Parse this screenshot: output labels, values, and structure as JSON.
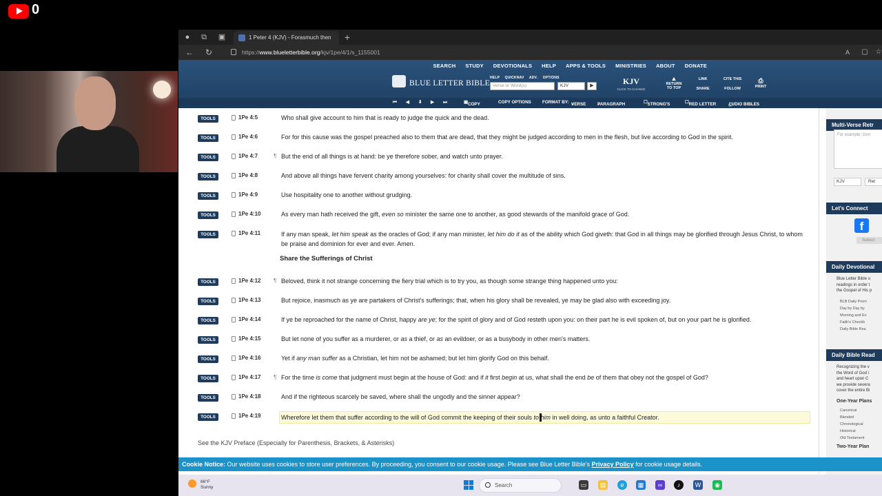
{
  "stream": {
    "view_count": "0"
  },
  "browser": {
    "tab_title": "1 Peter 4 (KJV) - Forasmuch then",
    "url_prefix": "https://",
    "url_host": "www.blueletterbible.org",
    "url_path": "/kjv/1pe/4/1/s_1155001"
  },
  "header": {
    "nav": [
      "SEARCH",
      "STUDY",
      "DEVOTIONALS",
      "HELP",
      "APPS & TOOLS",
      "MINISTRIES",
      "ABOUT",
      "DONATE"
    ],
    "logo": "BLUE LETTER BIBLE",
    "search_options": "HELP  QUICKNAV  ADV. OPTIONS",
    "search_placeholder": "Verse or Word(s)",
    "version": "KJV",
    "version_badge": "KJV",
    "version_badge_sub": "CLICK TO CHANGE",
    "return_to_top": "RETURN TO TOP",
    "link": "LINK",
    "share": "SHARE",
    "cite_this": "CITE THIS",
    "follow": "FOLLOW",
    "print": "PRINT"
  },
  "toolbar": {
    "copy": "COPY",
    "copy_options": "COPY OPTIONS",
    "format_by": "FORMAT BY:",
    "verse": "VERSE",
    "paragraph": "PARAGRAPH",
    "strongs": "STRONG'S",
    "red_letter": "RED LETTER",
    "audio_bibles": "AUDIO BIBLES"
  },
  "tools_label": "TOOLS",
  "verses_top": [
    {
      "ref": "1Pe 4:5",
      "para": "",
      "text": "Who shall give account to him that is ready to judge the quick and the dead."
    },
    {
      "ref": "1Pe 4:6",
      "para": "",
      "text": "For for this cause was the gospel preached also to them that are dead, that they might be judged according to men in the flesh, but live according to God in the spirit."
    },
    {
      "ref": "1Pe 4:7",
      "para": "¶",
      "text": "But the end of all things is at hand: be ye therefore sober, and watch unto prayer."
    },
    {
      "ref": "1Pe 4:8",
      "para": "",
      "text": "And above all things have fervent charity among yourselves: for charity shall cover the multitude of sins."
    },
    {
      "ref": "1Pe 4:9",
      "para": "",
      "text": "Use hospitality one to another without grudging."
    }
  ],
  "verse_10": {
    "ref": "1Pe 4:10",
    "a": "As every man hath received the gift, ",
    "b": "even so",
    "c": " minister the same one to another, as good stewards of the manifold grace of God."
  },
  "verse_11": {
    "ref": "1Pe 4:11",
    "a": "If any man speak, ",
    "b": "let him speak",
    "c": " as the oracles of God; if any man minister, ",
    "d": "let him do it",
    "e": " as of the ability which God giveth: that God in all things may be glorified through Jesus Christ, to whom be praise and dominion for ever and ever. Amen."
  },
  "section_heading": "Share the Sufferings of Christ",
  "verses_bottom": [
    {
      "ref": "1Pe 4:12",
      "para": "¶",
      "text": "Beloved, think it not strange concerning the fiery trial which is to try you, as though some strange thing happened unto you:"
    },
    {
      "ref": "1Pe 4:13",
      "para": "",
      "text": "But rejoice, inasmuch as ye are partakers of Christ's sufferings; that, when his glory shall be revealed, ye may be glad also with exceeding joy."
    }
  ],
  "verse_14": {
    "ref": "1Pe 4:14",
    "a": "If ye be reproached for the name of Christ, happy ",
    "b": "are ye",
    "c": "; for the spirit of glory and of God resteth upon you: on their part he is evil spoken of, but on your part he is glorified."
  },
  "verse_15": {
    "ref": "1Pe 4:15",
    "a": "But let none of you suffer as a murderer, or ",
    "b": "as",
    "c": " a thief, or ",
    "d": "as",
    "e": " an evildoer, or as a busybody in other men's matters."
  },
  "verse_16": {
    "ref": "1Pe 4:16",
    "a": "Yet if ",
    "b": "any man suffer",
    "c": " as a Christian, let him not be ashamed; but let him glorify God on this behalf."
  },
  "verse_17": {
    "ref": "1Pe 4:17",
    "para": "¶",
    "a": "For the time ",
    "b": "is come",
    "c": " that judgment must begin at the house of God: and if ",
    "d": "it",
    "e": " first ",
    "f": "begin",
    "g": " at us, what shall the end ",
    "h": "be",
    "i": " of them that obey not the gospel of God?"
  },
  "verse_18": {
    "ref": "1Pe 4:18",
    "text": "And if the righteous scarcely be saved, where shall the ungodly and the sinner appear?"
  },
  "verse_19": {
    "ref": "1Pe 4:19",
    "a": "Wherefore let them that suffer according to the will of God commit the keeping of their souls ",
    "b": "to him",
    "c": " in well doing, as unto a faithful Creator."
  },
  "preface_link": "See the KJV Preface (Especially for Parenthesis, Brackets, & Asterisks)",
  "sidebar": {
    "multi_verse_head": "Multi-Verse Retr",
    "multi_verse_placeholder": "For example: Gen",
    "version": "KJV",
    "retrieve": "Ret",
    "connect_head": "Let's Connect",
    "fb": "f",
    "subscribe": "Subscr",
    "devotionals_head": "Daily Devotional",
    "devotionals_text": [
      "Blue Letter Bible o",
      "readings in order t",
      "the Gospel of His p"
    ],
    "devotionals_list": [
      "BLB Daily Prom",
      "Day by Day by",
      "Morning and Ev",
      "Faith's Checkb",
      "Daily Bible Rea"
    ],
    "reading_head": "Daily Bible Read",
    "reading_text": [
      "Recognizing the v",
      "the Word of God i",
      "and heart upon C",
      "we provide severa",
      "cover the entire Bi"
    ],
    "one_year_head": "One-Year Plans",
    "one_year_list": [
      "Canonical",
      "Blended",
      "Chronological",
      "Historical",
      "Old Testament"
    ],
    "two_year_head": "Two-Year Plan"
  },
  "cookie": {
    "label": "Cookie Notice:",
    "text": " Our website uses cookies to store user preferences. By proceeding, you consent to our cookie usage. Please see Blue Letter Bible's ",
    "link": "Privacy Policy",
    "tail": " for cookie usage details."
  },
  "taskbar": {
    "temp": "66°F",
    "condition": "Sunny",
    "search": "Search"
  }
}
